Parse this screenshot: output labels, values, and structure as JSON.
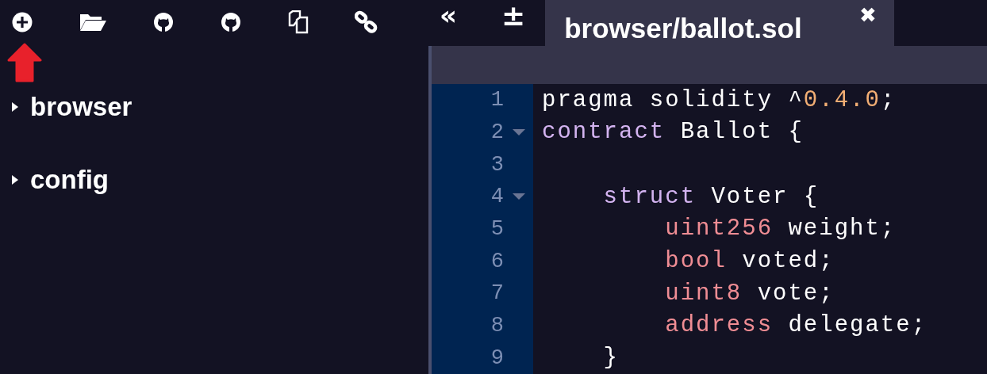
{
  "file_tree": [
    {
      "label": "browser",
      "expanded": false
    },
    {
      "label": "config",
      "expanded": false
    }
  ],
  "editor_toolbar": {
    "collapse_button": "«",
    "font_size_button": "±"
  },
  "tabs": [
    {
      "label": "browser/ballot.sol",
      "selected": true,
      "close": "✖"
    }
  ],
  "code_lines": [
    {
      "number": "1",
      "fold": false,
      "tokens": [
        {
          "kind": "plain",
          "text": "pragma solidity ^"
        },
        {
          "kind": "number",
          "text": "0.4.0"
        },
        {
          "kind": "plain",
          "text": ";"
        }
      ]
    },
    {
      "number": "2",
      "fold": true,
      "tokens": [
        {
          "kind": "keyword",
          "text": "contract"
        },
        {
          "kind": "plain",
          "text": " Ballot {"
        }
      ]
    },
    {
      "number": "3",
      "fold": false
    },
    {
      "number": "4",
      "fold": true,
      "tokens": [
        {
          "kind": "keyword",
          "text": "    struct"
        },
        {
          "kind": "plain",
          "text": " Voter {"
        }
      ]
    },
    {
      "number": "5",
      "fold": false,
      "tokens": [
        {
          "kind": "type",
          "text": "        uint256"
        },
        {
          "kind": "plain",
          "text": " weight;"
        }
      ]
    },
    {
      "number": "6",
      "fold": false,
      "tokens": [
        {
          "kind": "type",
          "text": "        bool"
        },
        {
          "kind": "plain",
          "text": " voted;"
        }
      ]
    },
    {
      "number": "7",
      "fold": false,
      "tokens": [
        {
          "kind": "type",
          "text": "        uint8"
        },
        {
          "kind": "plain",
          "text": " vote;"
        }
      ]
    },
    {
      "number": "8",
      "fold": false,
      "tokens": [
        {
          "kind": "type",
          "text": "        address"
        },
        {
          "kind": "plain",
          "text": " delegate;"
        }
      ]
    },
    {
      "number": "9",
      "fold": false,
      "tokens": [
        {
          "kind": "plain",
          "text": "    }"
        }
      ]
    }
  ]
}
